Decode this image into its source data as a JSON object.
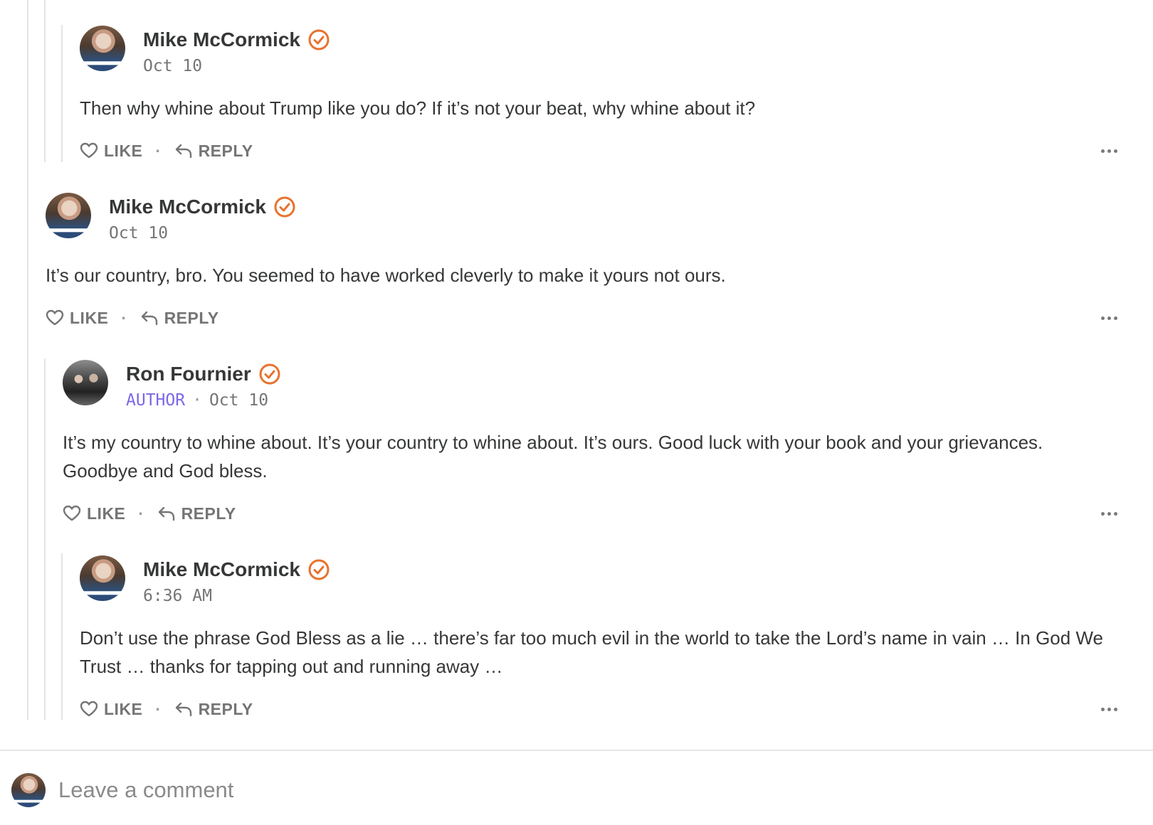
{
  "comments": [
    {
      "author": "Mike McCormick",
      "verified": true,
      "date": "Oct 10",
      "text": "Then why whine about Trump like you do? If it’s not your beat, why whine about it?",
      "like_label": "LIKE",
      "reply_label": "REPLY"
    },
    {
      "author": "Mike McCormick",
      "verified": true,
      "date": "Oct 10",
      "text": "It’s our country, bro. You seemed to have worked cleverly to make it yours not ours.",
      "like_label": "LIKE",
      "reply_label": "REPLY"
    },
    {
      "author": "Ron Fournier",
      "verified": true,
      "badge": "AUTHOR",
      "date": "Oct 10",
      "text": "It’s my country to whine about. It’s your country to whine about. It’s ours. Good luck with your book and your grievances. Goodbye and God bless.",
      "like_label": "LIKE",
      "reply_label": "REPLY"
    },
    {
      "author": "Mike McCormick",
      "verified": true,
      "date": "6:36 AM",
      "text": "Don’t use the phrase God Bless as a lie … there’s far too much evil in the world to take the Lord’s name in vain … In God We Trust … thanks for tapping out and running away …",
      "like_label": "LIKE",
      "reply_label": "REPLY"
    }
  ],
  "composer": {
    "placeholder": "Leave a comment"
  },
  "colors": {
    "verified_badge": "#e8722e",
    "author_badge": "#7b69e6",
    "text": "#363737",
    "muted": "#757575"
  }
}
